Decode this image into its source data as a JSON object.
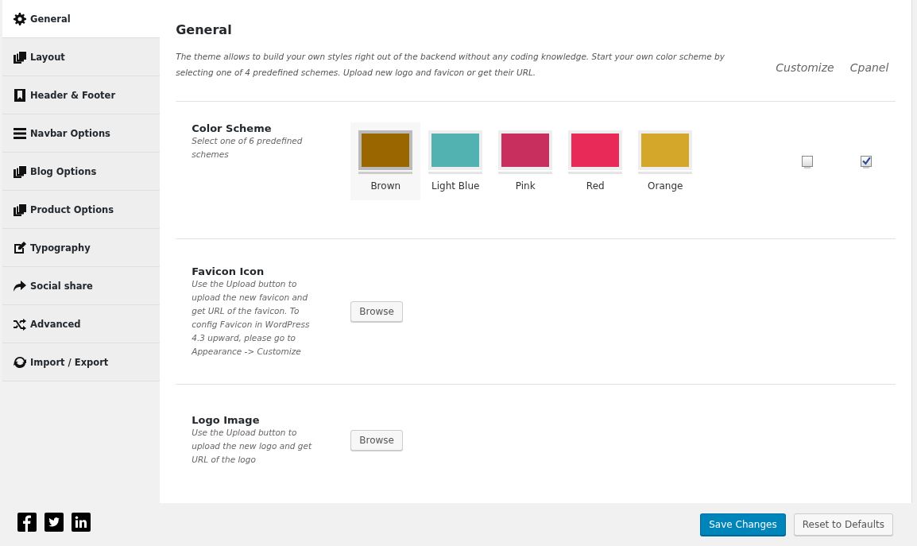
{
  "sidebar": {
    "items": [
      {
        "label": "General",
        "selected": true
      },
      {
        "label": "Layout",
        "selected": false
      },
      {
        "label": "Header & Footer",
        "selected": false
      },
      {
        "label": "Navbar Options",
        "selected": false
      },
      {
        "label": "Blog Options",
        "selected": false
      },
      {
        "label": "Product Options",
        "selected": false
      },
      {
        "label": "Typography",
        "selected": false
      },
      {
        "label": "Social share",
        "selected": false
      },
      {
        "label": "Advanced",
        "selected": false
      },
      {
        "label": "Import / Export",
        "selected": false
      }
    ]
  },
  "main": {
    "title": "General",
    "intro": "The theme allows to build your own styles right out of the backend without any coding knowledge. Start your own color scheme by selecting one of 4 predefined schemes. Upload new logo and favicon or get their URL.",
    "column_labels": [
      "Customize",
      "Cpanel"
    ],
    "sections": [
      {
        "kind": "colors",
        "title": "Color Scheme",
        "description": "Select one of 6 predefined schemes",
        "swatches": [
          {
            "label": "Brown",
            "color": "#996600",
            "selected": true
          },
          {
            "label": "Light Blue",
            "color": "#52b1b1",
            "selected": false
          },
          {
            "label": "Pink",
            "color": "#c92f5e",
            "selected": false
          },
          {
            "label": "Red",
            "color": "#e82a58",
            "selected": false
          },
          {
            "label": "Orange",
            "color": "#d4a72b",
            "selected": false
          }
        ],
        "checkboxes": [
          {
            "checked": false
          },
          {
            "checked": true
          }
        ]
      },
      {
        "kind": "upload",
        "title": "Favicon Icon",
        "description": "Use the Upload button to upload the new favicon and get URL of the favicon. To config Favicon in WordPress 4.3 upward, please go to Appearance -> Customize",
        "button": "Browse"
      },
      {
        "kind": "upload",
        "title": "Logo Image",
        "description": "Use the Upload button to upload the new logo and get URL of the logo",
        "button": "Browse"
      }
    ]
  },
  "footer": {
    "buttons": [
      {
        "label": "Save Changes",
        "kind": "primary"
      },
      {
        "label": "Reset to Defaults",
        "kind": "secondary"
      }
    ]
  }
}
